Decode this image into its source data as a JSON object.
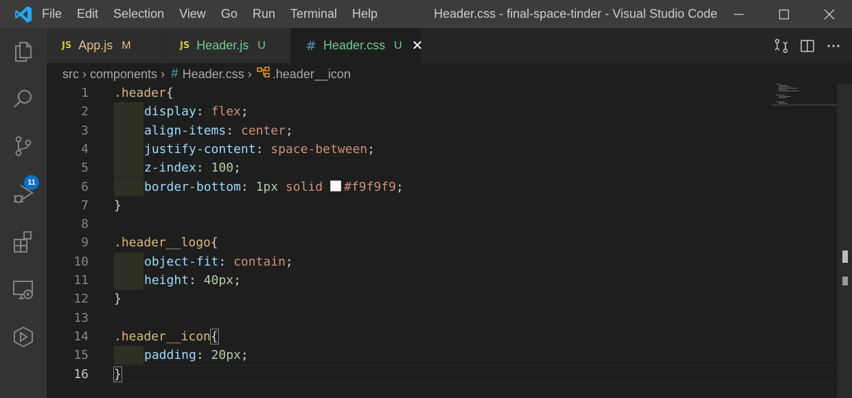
{
  "window": {
    "title": "Header.css - final-space-tinder - Visual Studio Code",
    "menu": [
      "File",
      "Edit",
      "Selection",
      "View",
      "Go",
      "Run",
      "Terminal",
      "Help"
    ]
  },
  "activity_bar": {
    "icons": [
      "explorer-icon",
      "search-icon",
      "source-control-icon",
      "run-debug-icon",
      "extensions-icon",
      "remote-explorer-icon",
      "live-share-icon"
    ],
    "source_control_badge": "11"
  },
  "tabs": [
    {
      "icon": "JS",
      "label": "App.js",
      "status": "M",
      "label_color": "#e2c08d",
      "active": false
    },
    {
      "icon": "JS",
      "label": "Header.js",
      "status": "U",
      "label_color": "#73c991",
      "active": false
    },
    {
      "icon": "#",
      "label": "Header.css",
      "status": "U",
      "label_color": "#73c991",
      "active": true
    }
  ],
  "breadcrumb": {
    "parts": [
      "src",
      "components",
      "Header.css",
      ".header__icon"
    ]
  },
  "editor": {
    "current_line": 16,
    "swatch_color": "#f9f9f9",
    "lines": [
      {
        "n": "1",
        "tokens": [
          {
            "t": ".header",
            "c": "sel"
          },
          {
            "t": "{",
            "c": "punc"
          }
        ]
      },
      {
        "n": "2",
        "indent": true,
        "tokens": [
          {
            "t": "display",
            "c": "prop"
          },
          {
            "t": ": ",
            "c": "punc"
          },
          {
            "t": "flex",
            "c": "val"
          },
          {
            "t": ";",
            "c": "punc"
          }
        ]
      },
      {
        "n": "3",
        "indent": true,
        "tokens": [
          {
            "t": "align-items",
            "c": "prop"
          },
          {
            "t": ": ",
            "c": "punc"
          },
          {
            "t": "center",
            "c": "val"
          },
          {
            "t": ";",
            "c": "punc"
          }
        ]
      },
      {
        "n": "4",
        "indent": true,
        "tokens": [
          {
            "t": "justify-content",
            "c": "prop"
          },
          {
            "t": ": ",
            "c": "punc"
          },
          {
            "t": "space-between",
            "c": "val"
          },
          {
            "t": ";",
            "c": "punc"
          }
        ]
      },
      {
        "n": "5",
        "indent": true,
        "tokens": [
          {
            "t": "z-index",
            "c": "prop"
          },
          {
            "t": ": ",
            "c": "punc"
          },
          {
            "t": "100",
            "c": "num"
          },
          {
            "t": ";",
            "c": "punc"
          }
        ]
      },
      {
        "n": "6",
        "indent": true,
        "tokens": [
          {
            "t": "border-bottom",
            "c": "prop"
          },
          {
            "t": ": ",
            "c": "punc"
          },
          {
            "t": "1px",
            "c": "num"
          },
          {
            "t": " ",
            "c": "punc"
          },
          {
            "t": "solid",
            "c": "val"
          },
          {
            "t": " ",
            "c": "punc"
          },
          {
            "t": "",
            "c": "swatch"
          },
          {
            "t": "#f9f9f9",
            "c": "val"
          },
          {
            "t": ";",
            "c": "punc"
          }
        ]
      },
      {
        "n": "7",
        "tokens": [
          {
            "t": "}",
            "c": "punc"
          }
        ]
      },
      {
        "n": "8",
        "tokens": []
      },
      {
        "n": "9",
        "tokens": [
          {
            "t": ".header__logo",
            "c": "sel"
          },
          {
            "t": "{",
            "c": "punc"
          }
        ]
      },
      {
        "n": "10",
        "indent": true,
        "tokens": [
          {
            "t": "object-fit",
            "c": "prop"
          },
          {
            "t": ": ",
            "c": "punc"
          },
          {
            "t": "contain",
            "c": "val"
          },
          {
            "t": ";",
            "c": "punc"
          }
        ]
      },
      {
        "n": "11",
        "indent": true,
        "tokens": [
          {
            "t": "height",
            "c": "prop"
          },
          {
            "t": ": ",
            "c": "punc"
          },
          {
            "t": "40px",
            "c": "num"
          },
          {
            "t": ";",
            "c": "punc"
          }
        ]
      },
      {
        "n": "12",
        "tokens": [
          {
            "t": "}",
            "c": "punc"
          }
        ]
      },
      {
        "n": "13",
        "tokens": []
      },
      {
        "n": "14",
        "tokens": [
          {
            "t": ".header__icon",
            "c": "sel"
          },
          {
            "t": "{",
            "c": "punc bracket-match"
          }
        ]
      },
      {
        "n": "15",
        "indent": true,
        "tokens": [
          {
            "t": "padding",
            "c": "prop"
          },
          {
            "t": ": ",
            "c": "punc"
          },
          {
            "t": "20px",
            "c": "num"
          },
          {
            "t": ";",
            "c": "punc"
          }
        ]
      },
      {
        "n": "16",
        "tokens": [
          {
            "t": "}",
            "c": "punc bracket-match"
          }
        ]
      }
    ]
  }
}
